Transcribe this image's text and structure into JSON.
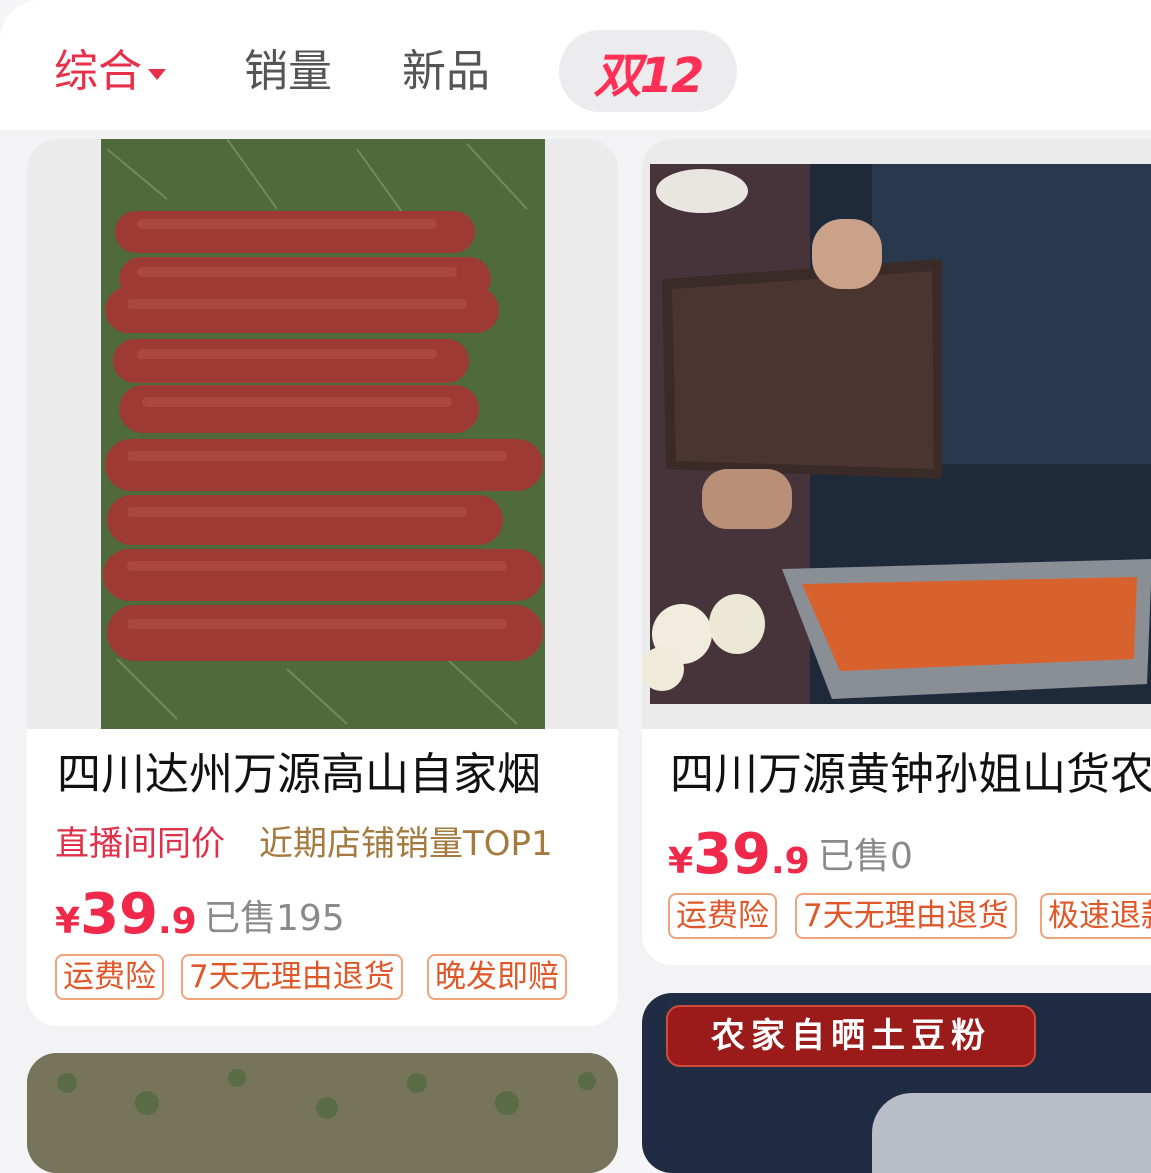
{
  "tabs": {
    "comprehensive": "综合",
    "sales": "销量",
    "new": "新品",
    "promo": "双12"
  },
  "products": [
    {
      "title": "四川达州万源高山自家烟",
      "live_tag": "直播间同价",
      "rank_tag": "近期店铺销量TOP1",
      "currency": "¥",
      "price_int": "39",
      "price_dec": ".9",
      "sold": "已售195",
      "badges": [
        "运费险",
        "7天无理由退货",
        "晚发即赔"
      ]
    },
    {
      "title": "四川万源黄钟孙姐山货农",
      "currency": "¥",
      "price_int": "39",
      "price_dec": ".9",
      "sold": "已售0",
      "badges": [
        "运费险",
        "7天无理由退货",
        "极速退款"
      ]
    },
    {
      "image_caption": "农家自晒土豆粉"
    }
  ],
  "colors": {
    "accent": "#e8304a",
    "price": "#f0284a",
    "badge": "#e0582a",
    "rank_tag": "#a47a3e"
  },
  "icons": {
    "sort_caret": "caret-down-icon"
  }
}
